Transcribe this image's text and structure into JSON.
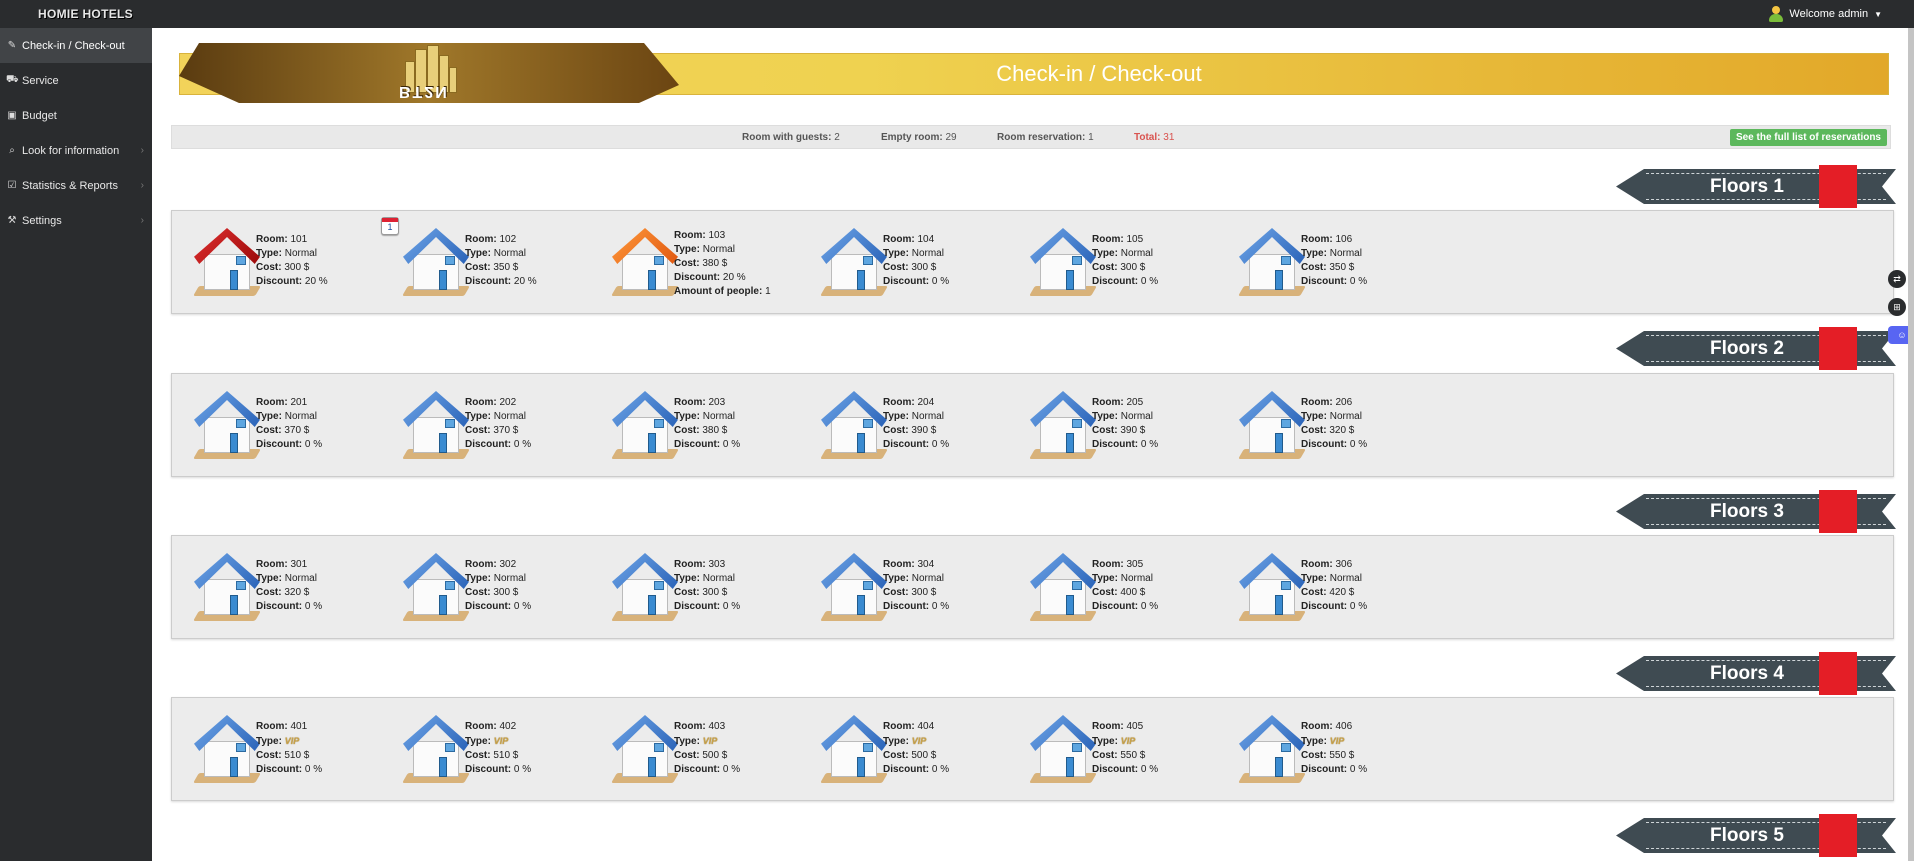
{
  "topbar": {
    "brand": "HOMIE HOTELS",
    "welcome": "Welcome admin"
  },
  "sidebar": {
    "items": [
      {
        "label": "Check-in / Check-out",
        "icon": "edit-icon",
        "active": true,
        "has_children": false
      },
      {
        "label": "Service",
        "icon": "cart-icon",
        "active": false,
        "has_children": false
      },
      {
        "label": "Budget",
        "icon": "money-icon",
        "active": false,
        "has_children": false
      },
      {
        "label": "Look for information",
        "icon": "search-icon",
        "active": false,
        "has_children": true
      },
      {
        "label": "Statistics & Reports",
        "icon": "calendar-check-icon",
        "active": false,
        "has_children": true
      },
      {
        "label": "Settings",
        "icon": "wrench-icon",
        "active": false,
        "has_children": true
      }
    ]
  },
  "banner": {
    "title": "Check-in / Check-out",
    "logo_text": "BT2N"
  },
  "stats": {
    "guests_label": "Room with guests:",
    "guests_value": "2",
    "empty_label": "Empty room:",
    "empty_value": "29",
    "reservation_label": "Room reservation:",
    "reservation_value": "1",
    "total_label": "Total:",
    "total_value": "31",
    "reservations_button": "See the full list of reservations"
  },
  "labels": {
    "room": "Room:",
    "type": "Type:",
    "cost": "Cost:",
    "discount": "Discount:",
    "people": "Amount of people:"
  },
  "colors": {
    "occupied": "#c0161b",
    "reserved_occupied": "#e86a1c",
    "empty": "#3a78cc",
    "ribbon": "#3f4b52",
    "ribbon_accent": "#e41e26"
  },
  "floors": [
    {
      "title": "Floors 1",
      "rooms": [
        {
          "room": "101",
          "type": "Normal",
          "cost": "300 $",
          "discount": "20 %",
          "status": "red"
        },
        {
          "room": "102",
          "type": "Normal",
          "cost": "350 $",
          "discount": "20 %",
          "status": "blue",
          "badge": "1"
        },
        {
          "room": "103",
          "type": "Normal",
          "cost": "380 $",
          "discount": "20 %",
          "status": "orange",
          "people": "1"
        },
        {
          "room": "104",
          "type": "Normal",
          "cost": "300 $",
          "discount": "0 %",
          "status": "blue"
        },
        {
          "room": "105",
          "type": "Normal",
          "cost": "300 $",
          "discount": "0 %",
          "status": "blue"
        },
        {
          "room": "106",
          "type": "Normal",
          "cost": "350 $",
          "discount": "0 %",
          "status": "blue"
        }
      ]
    },
    {
      "title": "Floors 2",
      "rooms": [
        {
          "room": "201",
          "type": "Normal",
          "cost": "370 $",
          "discount": "0 %",
          "status": "blue"
        },
        {
          "room": "202",
          "type": "Normal",
          "cost": "370 $",
          "discount": "0 %",
          "status": "blue"
        },
        {
          "room": "203",
          "type": "Normal",
          "cost": "380 $",
          "discount": "0 %",
          "status": "blue"
        },
        {
          "room": "204",
          "type": "Normal",
          "cost": "390 $",
          "discount": "0 %",
          "status": "blue"
        },
        {
          "room": "205",
          "type": "Normal",
          "cost": "390 $",
          "discount": "0 %",
          "status": "blue"
        },
        {
          "room": "206",
          "type": "Normal",
          "cost": "320 $",
          "discount": "0 %",
          "status": "blue"
        }
      ]
    },
    {
      "title": "Floors 3",
      "rooms": [
        {
          "room": "301",
          "type": "Normal",
          "cost": "320 $",
          "discount": "0 %",
          "status": "blue"
        },
        {
          "room": "302",
          "type": "Normal",
          "cost": "300 $",
          "discount": "0 %",
          "status": "blue"
        },
        {
          "room": "303",
          "type": "Normal",
          "cost": "300 $",
          "discount": "0 %",
          "status": "blue"
        },
        {
          "room": "304",
          "type": "Normal",
          "cost": "300 $",
          "discount": "0 %",
          "status": "blue"
        },
        {
          "room": "305",
          "type": "Normal",
          "cost": "400 $",
          "discount": "0 %",
          "status": "blue"
        },
        {
          "room": "306",
          "type": "Normal",
          "cost": "420 $",
          "discount": "0 %",
          "status": "blue"
        }
      ]
    },
    {
      "title": "Floors 4",
      "rooms": [
        {
          "room": "401",
          "type": "VIP",
          "cost": "510 $",
          "discount": "0 %",
          "status": "blue"
        },
        {
          "room": "402",
          "type": "VIP",
          "cost": "510 $",
          "discount": "0 %",
          "status": "blue"
        },
        {
          "room": "403",
          "type": "VIP",
          "cost": "500 $",
          "discount": "0 %",
          "status": "blue"
        },
        {
          "room": "404",
          "type": "VIP",
          "cost": "500 $",
          "discount": "0 %",
          "status": "blue"
        },
        {
          "room": "405",
          "type": "VIP",
          "cost": "550 $",
          "discount": "0 %",
          "status": "blue"
        },
        {
          "room": "406",
          "type": "VIP",
          "cost": "550 $",
          "discount": "0 %",
          "status": "blue"
        }
      ]
    },
    {
      "title": "Floors 5",
      "rooms": []
    }
  ]
}
